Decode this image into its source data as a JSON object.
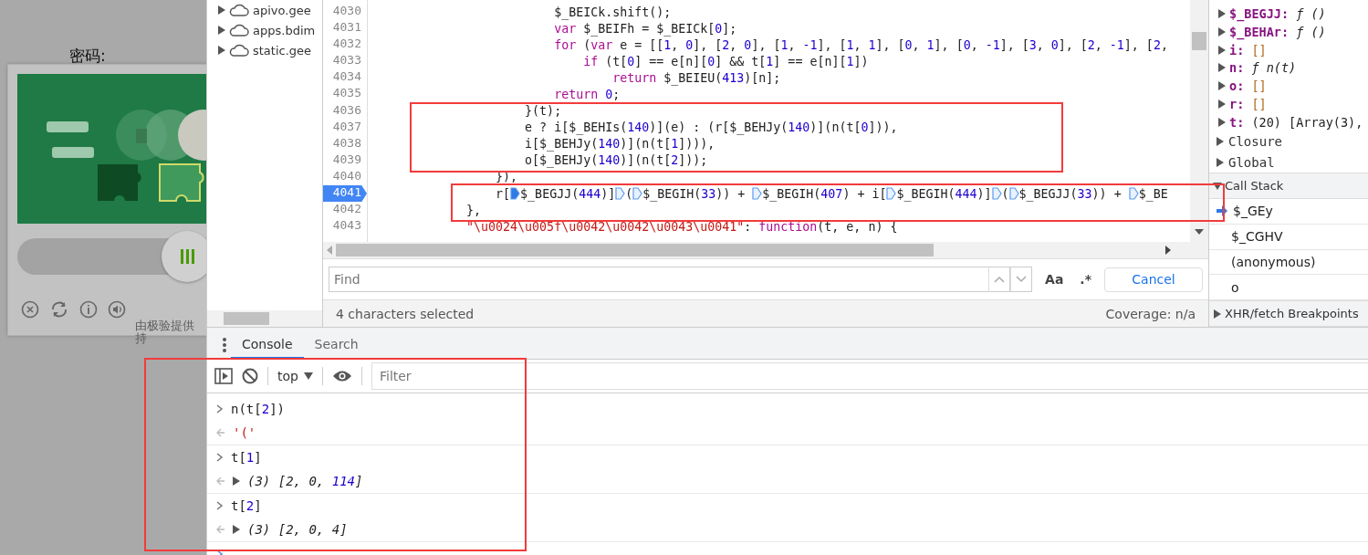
{
  "page": {
    "field_label": "密码:",
    "captcha": {
      "kind": "slider"
    },
    "powered_by": [
      "由极验提供",
      "持"
    ]
  },
  "navigator": {
    "items": [
      {
        "label": "apivo.gee",
        "expanded": false
      },
      {
        "label": "apps.bdim",
        "expanded": false
      },
      {
        "label": "static.gee",
        "expanded": false
      }
    ]
  },
  "code": {
    "lines": [
      {
        "number": "4030",
        "current": false,
        "tokens": [
          {
            "kind": "plain",
            "text": "                        $_BEICk.shift();"
          }
        ]
      },
      {
        "number": "4031",
        "current": false,
        "tokens": [
          {
            "kind": "keyword",
            "text": "                        var"
          },
          {
            "kind": "plain",
            "text": " $_BEIFh = $_BEICk["
          },
          {
            "kind": "number",
            "text": "0"
          },
          {
            "kind": "plain",
            "text": "];"
          }
        ]
      },
      {
        "number": "4032",
        "current": false,
        "tokens": [
          {
            "kind": "keyword",
            "text": "                        for"
          },
          {
            "kind": "plain",
            "text": " ("
          },
          {
            "kind": "keyword",
            "text": "var"
          },
          {
            "kind": "plain",
            "text": " e = [["
          },
          {
            "kind": "number",
            "text": "1"
          },
          {
            "kind": "plain",
            "text": ", "
          },
          {
            "kind": "number",
            "text": "0"
          },
          {
            "kind": "plain",
            "text": "], ["
          },
          {
            "kind": "number",
            "text": "2"
          },
          {
            "kind": "plain",
            "text": ", "
          },
          {
            "kind": "number",
            "text": "0"
          },
          {
            "kind": "plain",
            "text": "], ["
          },
          {
            "kind": "number",
            "text": "1"
          },
          {
            "kind": "plain",
            "text": ", "
          },
          {
            "kind": "number",
            "text": "-1"
          },
          {
            "kind": "plain",
            "text": "], ["
          },
          {
            "kind": "number",
            "text": "1"
          },
          {
            "kind": "plain",
            "text": ", "
          },
          {
            "kind": "number",
            "text": "1"
          },
          {
            "kind": "plain",
            "text": "], ["
          },
          {
            "kind": "number",
            "text": "0"
          },
          {
            "kind": "plain",
            "text": ", "
          },
          {
            "kind": "number",
            "text": "1"
          },
          {
            "kind": "plain",
            "text": "], ["
          },
          {
            "kind": "number",
            "text": "0"
          },
          {
            "kind": "plain",
            "text": ", "
          },
          {
            "kind": "number",
            "text": "-1"
          },
          {
            "kind": "plain",
            "text": "], ["
          },
          {
            "kind": "number",
            "text": "3"
          },
          {
            "kind": "plain",
            "text": ", "
          },
          {
            "kind": "number",
            "text": "0"
          },
          {
            "kind": "plain",
            "text": "], ["
          },
          {
            "kind": "number",
            "text": "2"
          },
          {
            "kind": "plain",
            "text": ", "
          },
          {
            "kind": "number",
            "text": "-1"
          },
          {
            "kind": "plain",
            "text": "], ["
          },
          {
            "kind": "number",
            "text": "2"
          },
          {
            "kind": "plain",
            "text": ","
          }
        ]
      },
      {
        "number": "4033",
        "current": false,
        "tokens": [
          {
            "kind": "keyword",
            "text": "                            if"
          },
          {
            "kind": "plain",
            "text": " (t["
          },
          {
            "kind": "number",
            "text": "0"
          },
          {
            "kind": "plain",
            "text": "] == e[n]["
          },
          {
            "kind": "number",
            "text": "0"
          },
          {
            "kind": "plain",
            "text": "] && t["
          },
          {
            "kind": "number",
            "text": "1"
          },
          {
            "kind": "plain",
            "text": "] == e[n]["
          },
          {
            "kind": "number",
            "text": "1"
          },
          {
            "kind": "plain",
            "text": "])"
          }
        ]
      },
      {
        "number": "4034",
        "current": false,
        "tokens": [
          {
            "kind": "keyword",
            "text": "                                return"
          },
          {
            "kind": "plain",
            "text": " $_BEIEU("
          },
          {
            "kind": "number",
            "text": "413"
          },
          {
            "kind": "plain",
            "text": ")[n];"
          }
        ]
      },
      {
        "number": "4035",
        "current": false,
        "tokens": [
          {
            "kind": "keyword",
            "text": "                        return"
          },
          {
            "kind": "number",
            "text": " 0"
          },
          {
            "kind": "plain",
            "text": ";"
          }
        ]
      },
      {
        "number": "4036",
        "current": false,
        "tokens": [
          {
            "kind": "plain",
            "text": "                    }(t);"
          }
        ]
      },
      {
        "number": "4037",
        "current": false,
        "tokens": [
          {
            "kind": "plain",
            "text": "                    e ? i[$_BEHIs("
          },
          {
            "kind": "number",
            "text": "140"
          },
          {
            "kind": "plain",
            "text": ")](e) : (r[$_BEHJy("
          },
          {
            "kind": "number",
            "text": "140"
          },
          {
            "kind": "plain",
            "text": ")](n(t["
          },
          {
            "kind": "number",
            "text": "0"
          },
          {
            "kind": "plain",
            "text": "])),"
          }
        ]
      },
      {
        "number": "4038",
        "current": false,
        "tokens": [
          {
            "kind": "plain",
            "text": "                    i[$_BEHJy("
          },
          {
            "kind": "number",
            "text": "140"
          },
          {
            "kind": "plain",
            "text": ")](n(t["
          },
          {
            "kind": "number",
            "text": "1"
          },
          {
            "kind": "plain",
            "text": "]))),"
          }
        ]
      },
      {
        "number": "4039",
        "current": false,
        "tokens": [
          {
            "kind": "plain",
            "text": "                    o[$_BEHJy("
          },
          {
            "kind": "number",
            "text": "140"
          },
          {
            "kind": "plain",
            "text": ")](n(t["
          },
          {
            "kind": "number",
            "text": "2"
          },
          {
            "kind": "plain",
            "text": "]));"
          }
        ]
      },
      {
        "number": "4040",
        "current": false,
        "tokens": [
          {
            "kind": "plain",
            "text": "                }),"
          }
        ]
      },
      {
        "number": "4041",
        "current": true,
        "tokens": [
          {
            "kind": "plain",
            "text": "                r["
          },
          {
            "kind": "marker",
            "active": true
          },
          {
            "kind": "plain",
            "text": "$_BEGJJ("
          },
          {
            "kind": "number",
            "text": "444"
          },
          {
            "kind": "plain",
            "text": ")]"
          },
          {
            "kind": "marker",
            "active": false
          },
          {
            "kind": "plain",
            "text": "("
          },
          {
            "kind": "marker",
            "active": false
          },
          {
            "kind": "plain",
            "text": "$_BEGIH("
          },
          {
            "kind": "number",
            "text": "33"
          },
          {
            "kind": "plain",
            "text": ")) + "
          },
          {
            "kind": "marker",
            "active": false
          },
          {
            "kind": "plain",
            "text": "$_BEGIH("
          },
          {
            "kind": "number",
            "text": "407"
          },
          {
            "kind": "plain",
            "text": ") + i["
          },
          {
            "kind": "marker",
            "active": false
          },
          {
            "kind": "plain",
            "text": "$_BEGIH("
          },
          {
            "kind": "number",
            "text": "444"
          },
          {
            "kind": "plain",
            "text": ")]"
          },
          {
            "kind": "marker",
            "active": false
          },
          {
            "kind": "plain",
            "text": "("
          },
          {
            "kind": "marker",
            "active": false
          },
          {
            "kind": "plain",
            "text": "$_BEGJJ("
          },
          {
            "kind": "number",
            "text": "33"
          },
          {
            "kind": "plain",
            "text": ")) + "
          },
          {
            "kind": "marker",
            "active": false
          },
          {
            "kind": "plain",
            "text": "$_BE"
          }
        ]
      },
      {
        "number": "4042",
        "current": false,
        "tokens": [
          {
            "kind": "plain",
            "text": "            },"
          }
        ]
      },
      {
        "number": "4043",
        "current": false,
        "tokens": [
          {
            "kind": "string",
            "text": "            \"\\u0024\\u005f\\u0042\\u0042\\u0043\\u0041\""
          },
          {
            "kind": "plain",
            "text": ": "
          },
          {
            "kind": "keyword",
            "text": "function"
          },
          {
            "kind": "plain",
            "text": "(t, e, n) {"
          }
        ]
      }
    ]
  },
  "find_bar": {
    "placeholder": "Find",
    "match_case": "Aa",
    "regex": ".*",
    "cancel": "Cancel"
  },
  "status_bar": {
    "selection": "4 characters selected",
    "coverage": "Coverage: n/a"
  },
  "scope": {
    "properties": [
      {
        "name": "$_BEGJJ:",
        "value": "ƒ ()",
        "kind": "function"
      },
      {
        "name": "$_BEHAr:",
        "value": "ƒ ()",
        "kind": "function"
      },
      {
        "name": "i:",
        "value": "[]",
        "kind": "list"
      },
      {
        "name": "n:",
        "value": "ƒ n(t)",
        "kind": "function"
      },
      {
        "name": "o:",
        "value": "[]",
        "kind": "list"
      },
      {
        "name": "r:",
        "value": "[]",
        "kind": "list"
      },
      {
        "name": "t:",
        "value": "(20) [Array(3),",
        "kind": "preview"
      }
    ],
    "sections": [
      {
        "label": "Closure",
        "expanded": false
      },
      {
        "label": "Global",
        "expanded": false
      }
    ]
  },
  "call_stack": {
    "label": "Call Stack",
    "expanded": true,
    "frames": [
      {
        "label": "$_GEy",
        "selected": true
      },
      {
        "label": "$_CGHV",
        "selected": false
      },
      {
        "label": "(anonymous)",
        "selected": false
      },
      {
        "label": "o",
        "selected": false
      }
    ]
  },
  "xhr_breakpoints": {
    "label": "XHR/fetch Breakpoints",
    "expanded": false
  },
  "drawer": {
    "tabs": [
      {
        "label": "Console",
        "selected": true
      },
      {
        "label": "Search",
        "selected": false
      }
    ],
    "context": "top",
    "filter_placeholder": "Filter",
    "entries": [
      {
        "kind": "input",
        "expandable": false,
        "tokens": [
          {
            "kind": "plain",
            "text": "n(t["
          },
          {
            "kind": "number",
            "text": "2"
          },
          {
            "kind": "plain",
            "text": "])"
          }
        ]
      },
      {
        "kind": "output",
        "expandable": false,
        "tokens": [
          {
            "kind": "string",
            "text": "'('"
          }
        ]
      },
      {
        "kind": "input",
        "expandable": false,
        "tokens": [
          {
            "kind": "plain",
            "text": "t["
          },
          {
            "kind": "number",
            "text": "1"
          },
          {
            "kind": "plain",
            "text": "]"
          }
        ]
      },
      {
        "kind": "output",
        "expandable": true,
        "tokens": [
          {
            "kind": "plain",
            "text": "(3) [2, 0, "
          },
          {
            "kind": "number",
            "text": "114"
          },
          {
            "kind": "plain",
            "text": "]"
          }
        ]
      },
      {
        "kind": "input",
        "expandable": false,
        "tokens": [
          {
            "kind": "plain",
            "text": "t["
          },
          {
            "kind": "number",
            "text": "2"
          },
          {
            "kind": "plain",
            "text": "]"
          }
        ]
      },
      {
        "kind": "output",
        "expandable": true,
        "tokens": [
          {
            "kind": "plain",
            "text": "(3) [2, 0, 4]"
          }
        ]
      },
      {
        "kind": "prompt"
      }
    ]
  },
  "annotation_frames": [
    {
      "color": "#f23b3b"
    },
    {
      "color": "#f23b3b"
    },
    {
      "color": "#f23b3b"
    }
  ]
}
